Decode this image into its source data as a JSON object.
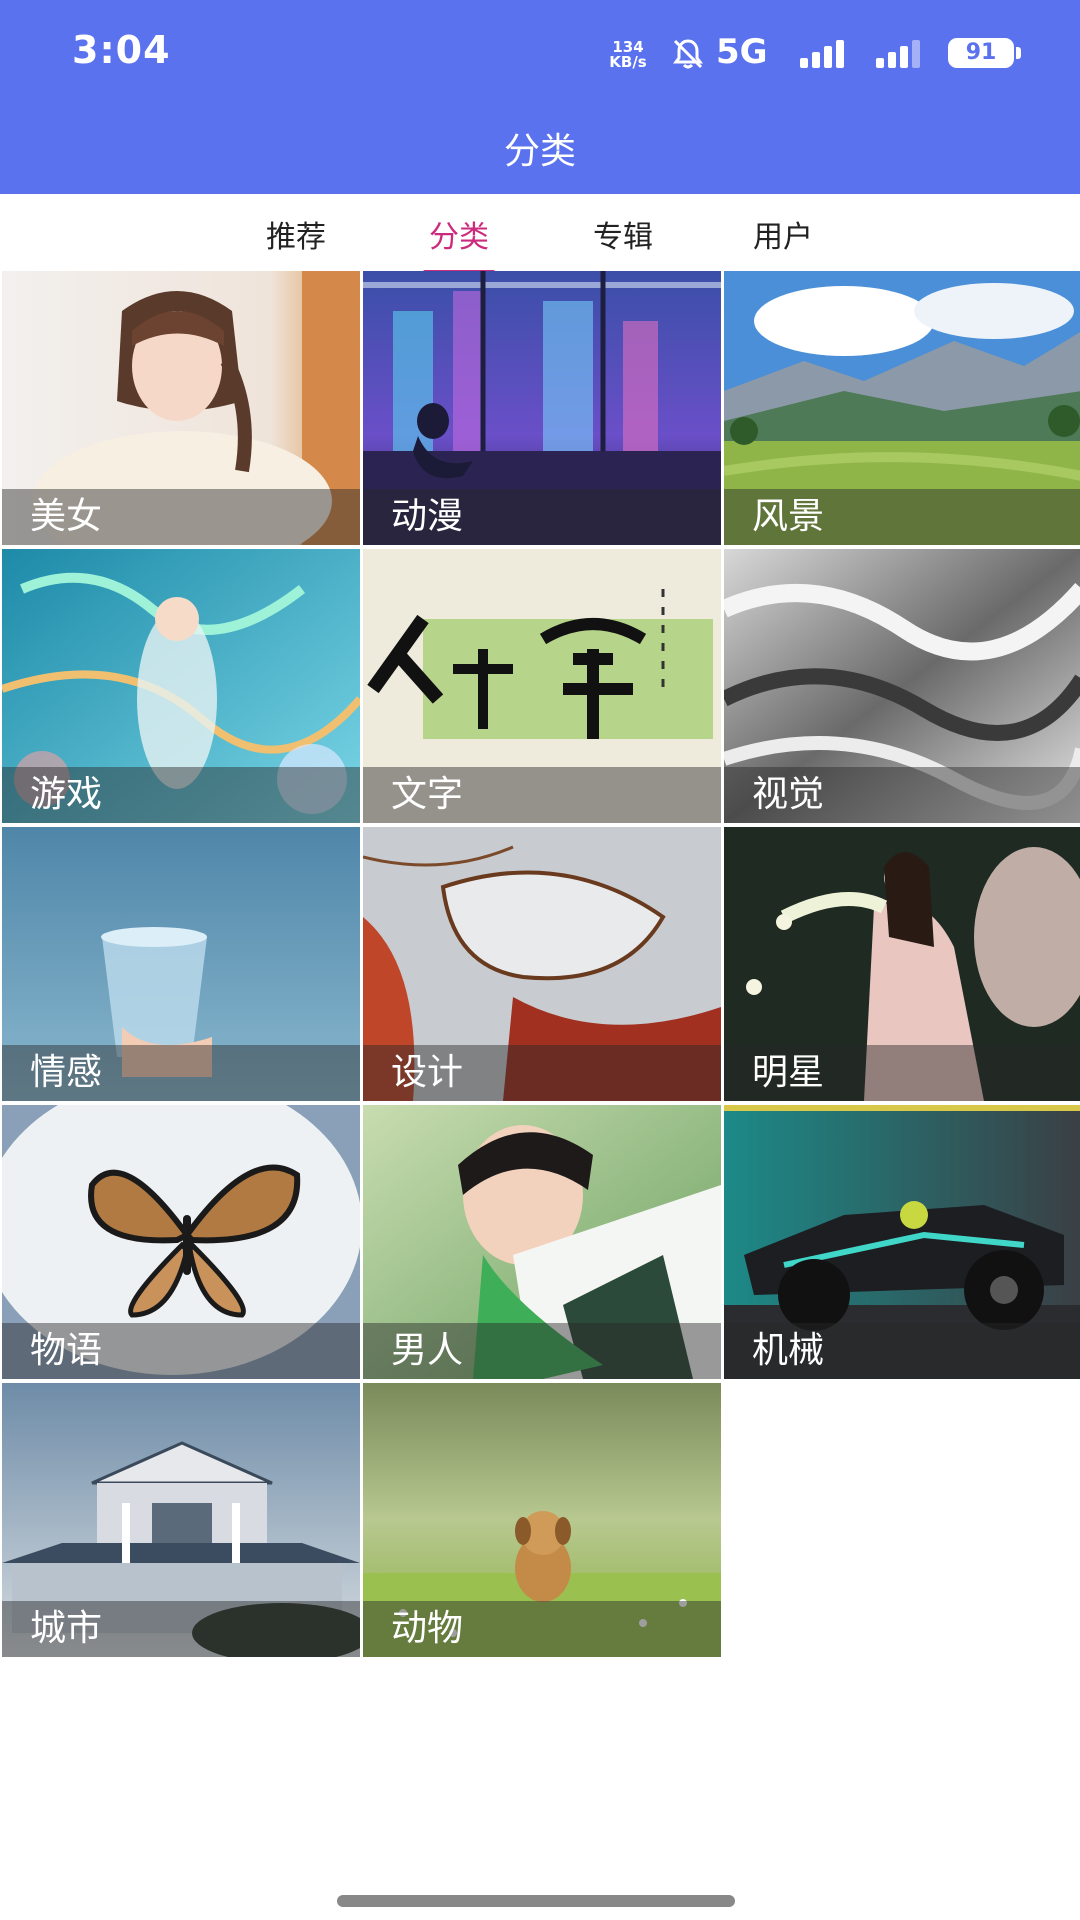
{
  "status_bar": {
    "time": "3:04",
    "net_speed_value": "134",
    "net_speed_unit": "KB/s",
    "network": "5G",
    "battery": "91",
    "icons": [
      "bell-muted-icon",
      "signal-icon",
      "signal-icon",
      "battery-icon"
    ]
  },
  "app_bar": {
    "title": "分类"
  },
  "tabs": [
    {
      "label": "推荐",
      "active": false
    },
    {
      "label": "分类",
      "active": true
    },
    {
      "label": "专辑",
      "active": false
    },
    {
      "label": "用户",
      "active": false
    }
  ],
  "categories": [
    {
      "label": "美女"
    },
    {
      "label": "动漫"
    },
    {
      "label": "风景"
    },
    {
      "label": "游戏"
    },
    {
      "label": "文字"
    },
    {
      "label": "视觉"
    },
    {
      "label": "情感"
    },
    {
      "label": "设计"
    },
    {
      "label": "明星"
    },
    {
      "label": "物语"
    },
    {
      "label": "男人"
    },
    {
      "label": "机械"
    },
    {
      "label": "城市"
    },
    {
      "label": "动物"
    }
  ],
  "colors": {
    "app_bar": "#5b72ee",
    "tab_active": "#cc2a7c",
    "tab_inactive": "#222222"
  }
}
